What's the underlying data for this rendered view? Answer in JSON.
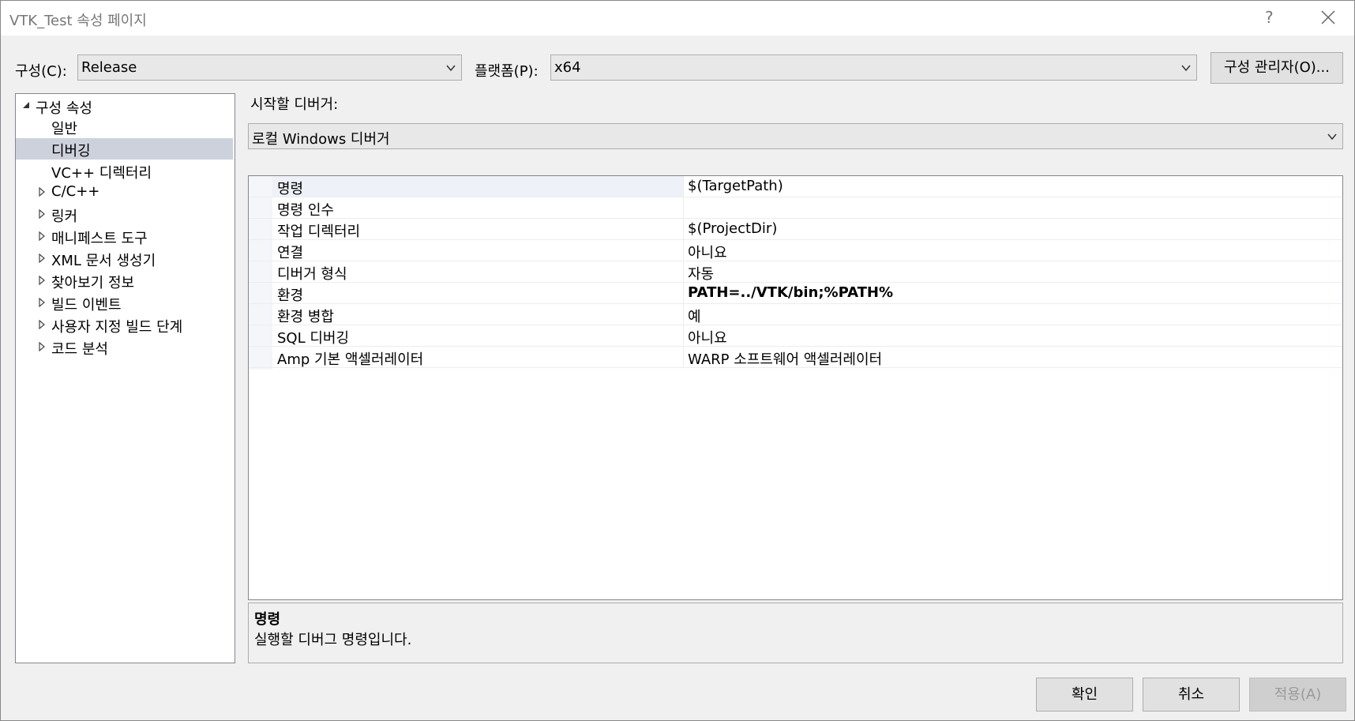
{
  "window": {
    "title": "VTK_Test 속성 페이지",
    "help_label": "?"
  },
  "toolbar": {
    "config_label": "구성(C):",
    "config_value": "Release",
    "platform_label": "플랫폼(P):",
    "platform_value": "x64",
    "config_manager_label": "구성 관리자(O)..."
  },
  "tree": {
    "root_label": "구성 속성",
    "items": [
      {
        "label": "일반",
        "expandable": false,
        "selected": false
      },
      {
        "label": "디버깅",
        "expandable": false,
        "selected": true
      },
      {
        "label": "VC++ 디렉터리",
        "expandable": false,
        "selected": false
      },
      {
        "label": "C/C++",
        "expandable": true,
        "selected": false
      },
      {
        "label": "링커",
        "expandable": true,
        "selected": false
      },
      {
        "label": "매니페스트 도구",
        "expandable": true,
        "selected": false
      },
      {
        "label": "XML 문서 생성기",
        "expandable": true,
        "selected": false
      },
      {
        "label": "찾아보기 정보",
        "expandable": true,
        "selected": false
      },
      {
        "label": "빌드 이벤트",
        "expandable": true,
        "selected": false
      },
      {
        "label": "사용자 지정 빌드 단계",
        "expandable": true,
        "selected": false
      },
      {
        "label": "코드 분석",
        "expandable": true,
        "selected": false
      }
    ]
  },
  "debugger": {
    "label": "시작할 디버거:",
    "value": "로컬 Windows 디버거"
  },
  "properties": [
    {
      "name": "명령",
      "value": "$(TargetPath)",
      "bold": false
    },
    {
      "name": "명령 인수",
      "value": "",
      "bold": false
    },
    {
      "name": "작업 디렉터리",
      "value": "$(ProjectDir)",
      "bold": false
    },
    {
      "name": "연결",
      "value": "아니요",
      "bold": false
    },
    {
      "name": "디버거 형식",
      "value": "자동",
      "bold": false
    },
    {
      "name": "환경",
      "value": "PATH=../VTK/bin;%PATH%",
      "bold": true
    },
    {
      "name": "환경 병합",
      "value": "예",
      "bold": false
    },
    {
      "name": "SQL 디버깅",
      "value": "아니요",
      "bold": false
    },
    {
      "name": "Amp 기본 액셀러레이터",
      "value": "WARP 소프트웨어 액셀러레이터",
      "bold": false
    }
  ],
  "description": {
    "title": "명령",
    "body": "실행할 디버그 명령입니다."
  },
  "buttons": {
    "ok": "확인",
    "cancel": "취소",
    "apply": "적용(A)"
  },
  "colors": {
    "selection": "#cdd1dc",
    "window_bg": "#f0f0f0"
  }
}
